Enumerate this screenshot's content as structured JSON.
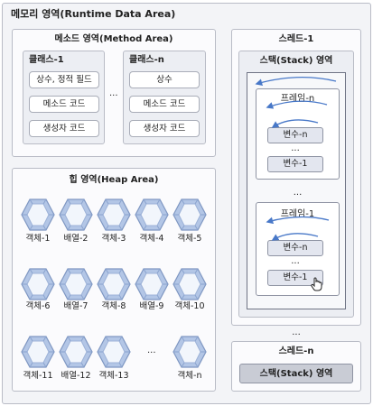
{
  "memory_title": "메모리 영역(Runtime Data Area)",
  "method_area": {
    "title": "메소드 영역(Method Area)",
    "class1": {
      "title": "클래스-1",
      "items": [
        "상수, 정적 필드",
        "메소드 코드",
        "생성자 코드"
      ]
    },
    "ellipsis": "...",
    "classN": {
      "title": "클래스-n",
      "items": [
        "상수",
        "메소드 코드",
        "생성자 코드"
      ]
    }
  },
  "heap_area": {
    "title": "힙 영역(Heap Area)",
    "objects": [
      "객체-1",
      "배열-2",
      "객체-3",
      "객체-4",
      "객체-5",
      "객체-6",
      "배열-7",
      "객체-8",
      "배열-9",
      "객체-10",
      "객체-11",
      "배열-12",
      "객체-13",
      "객체-n"
    ],
    "ellipsis": "..."
  },
  "thread1": {
    "title": "스레드-1",
    "stack_title": "스택(Stack) 영역",
    "frame_n": {
      "title": "프레임-n",
      "vars": [
        "변수-n",
        "변수-1"
      ],
      "ellipsis": "..."
    },
    "between": "...",
    "frame_1": {
      "title": "프레임-1",
      "vars": [
        "변수-n",
        "변수-1"
      ],
      "ellipsis": "..."
    }
  },
  "between_threads": "...",
  "threadN": {
    "title": "스레드-n",
    "stack_title": "스택(Stack) 영역"
  }
}
